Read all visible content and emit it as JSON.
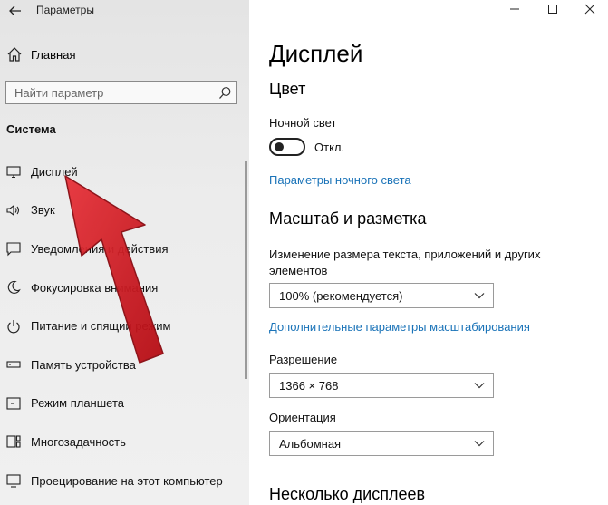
{
  "window": {
    "title": "Параметры",
    "controls": [
      "minimize-icon",
      "maximize-icon",
      "close-icon"
    ]
  },
  "sidebar": {
    "home_label": "Главная",
    "search_placeholder": "Найти параметр",
    "section": "Система",
    "items": [
      {
        "label": "Дисплей",
        "icon": "monitor-icon"
      },
      {
        "label": "Звук",
        "icon": "speaker-icon"
      },
      {
        "label": "Уведомления и действия",
        "icon": "notification-icon"
      },
      {
        "label": "Фокусировка внимания",
        "icon": "moon-icon"
      },
      {
        "label": "Питание и спящий режим",
        "icon": "power-icon"
      },
      {
        "label": "Память устройства",
        "icon": "storage-icon"
      },
      {
        "label": "Режим планшета",
        "icon": "tablet-icon"
      },
      {
        "label": "Многозадачность",
        "icon": "multitask-icon"
      },
      {
        "label": "Проецирование на этот компьютер",
        "icon": "project-icon"
      }
    ]
  },
  "content": {
    "title": "Дисплей",
    "color_heading": "Цвет",
    "night_light_label": "Ночной свет",
    "night_light_state": "Откл.",
    "night_light_link": "Параметры ночного света",
    "scale_heading": "Масштаб и разметка",
    "scale_label": "Изменение размера текста, приложений и других элементов",
    "scale_value": "100% (рекомендуется)",
    "scale_link": "Дополнительные параметры масштабирования",
    "resolution_label": "Разрешение",
    "resolution_value": "1366 × 768",
    "orientation_label": "Ориентация",
    "orientation_value": "Альбомная",
    "multi_heading": "Несколько дисплеев"
  },
  "colors": {
    "link": "#1a73b8",
    "annotation_arrow": "#d4101a"
  }
}
